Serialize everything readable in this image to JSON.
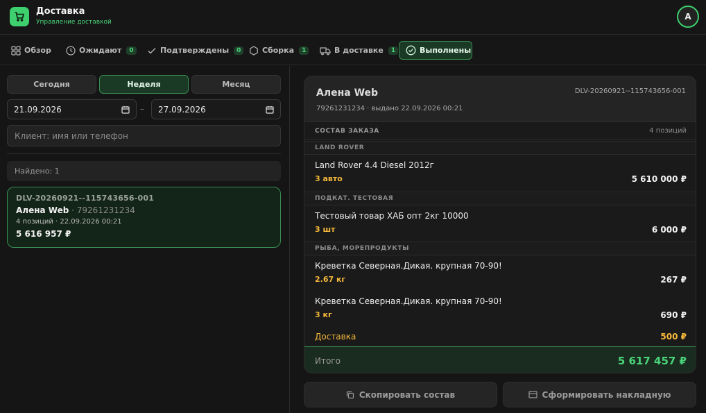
{
  "app": {
    "title": "Доставка",
    "subtitle": "Управление доставкой",
    "avatar_initial": "A"
  },
  "tabs": [
    {
      "label": "Обзор",
      "icon": "grid-icon",
      "count": null
    },
    {
      "label": "Ожидают",
      "icon": "clock-icon",
      "count": "0"
    },
    {
      "label": "Подтверждены",
      "icon": "check-icon",
      "count": "0"
    },
    {
      "label": "Сборка",
      "icon": "hexagon-icon",
      "count": "1"
    },
    {
      "label": "В доставке",
      "icon": "truck-icon",
      "count": "1"
    },
    {
      "label": "Выполнены",
      "icon": "check-circle-icon",
      "count": null,
      "active": true
    }
  ],
  "filters": {
    "periods": [
      "Сегодня",
      "Неделя",
      "Месяц"
    ],
    "active_period": "Неделя",
    "date_from": "21.09.2026",
    "date_separator": "–",
    "date_to": "27.09.2026",
    "search_placeholder": "Клиент: имя или телефон"
  },
  "results": {
    "found_label": "Найдено: 1",
    "orders": [
      {
        "id": "DLV-20260921--115743656-001",
        "name": "Алена Web",
        "phone_sep": " · ",
        "phone": "79261231234",
        "meta": "4 позиций · 22.09.2026 00:21",
        "sum": "5 616 957 ₽"
      }
    ]
  },
  "detail": {
    "customer_name": "Алена Web",
    "customer_meta": "79261231234 · выдано 22.09.2026 00:21",
    "order_id": "DLV-20260921--115743656-001",
    "section_title": "СОСТАВ ЗАКАЗА",
    "positions_count": "4 позиций",
    "categories": [
      {
        "name": "LAND ROVER",
        "items": [
          {
            "title": "Land Rover 4.4 Diesel 2012г",
            "qty": "3 авто",
            "price": "5 610 000 ₽"
          }
        ]
      },
      {
        "name": "ПОДКАТ. ТЕСТОВАЯ",
        "items": [
          {
            "title": "Тестовый товар ХАБ опт 2кг 10000",
            "qty": "3 шт",
            "price": "6 000 ₽"
          }
        ]
      },
      {
        "name": "РЫБА, МОРЕПРОДУКТЫ",
        "items": [
          {
            "title": "Креветка Северная.Дикая. крупная 70-90!",
            "qty": "2.67 кг",
            "price": "267 ₽"
          },
          {
            "title": "Креветка Северная.Дикая. крупная 70-90!",
            "qty": "3 кг",
            "price": "690 ₽"
          }
        ]
      }
    ],
    "delivery_label": "Доставка",
    "delivery_value": "500 ₽",
    "total_label": "Итого",
    "total_value": "5 617 457 ₽"
  },
  "actions": {
    "copy_label": "Скопировать состав",
    "invoice_label": "Сформировать накладную"
  },
  "colors": {
    "accent": "#3ecf6e",
    "warning": "#f5b83a",
    "background": "#151515"
  }
}
